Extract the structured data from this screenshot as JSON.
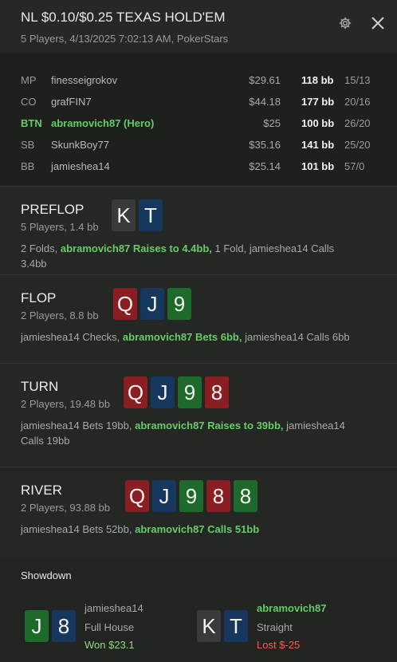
{
  "header": {
    "title": "NL $0.10/$0.25 TEXAS HOLD'EM",
    "subtitle": "5 Players, 4/13/2025 7:02:13 AM, PokerStars",
    "settings_icon": "gear-icon",
    "close_icon": "close-icon"
  },
  "players": [
    {
      "position": "MP",
      "name": "finesseigrokov",
      "stack": "$29.61",
      "bb": "118 bb",
      "stat": "15/13",
      "hero": false
    },
    {
      "position": "CO",
      "name": "grafFIN7",
      "stack": "$44.18",
      "bb": "177 bb",
      "stat": "20/16",
      "hero": false
    },
    {
      "position": "BTN",
      "name": "abramovich87 (Hero)",
      "stack": "$25",
      "bb": "100 bb",
      "stat": "26/20",
      "hero": true
    },
    {
      "position": "SB",
      "name": "SkunkBoy77",
      "stack": "$35.16",
      "bb": "141 bb",
      "stat": "25/20",
      "hero": false
    },
    {
      "position": "BB",
      "name": "jamieshea14",
      "stack": "$25.14",
      "bb": "101 bb",
      "stat": "57/0",
      "hero": false
    }
  ],
  "streets": {
    "preflop": {
      "name": "PREFLOP",
      "info": "5 Players, 1.4 bb",
      "cards": [
        {
          "rank": "K",
          "suit": "spades"
        },
        {
          "rank": "T",
          "suit": "diamonds"
        }
      ],
      "actions": [
        {
          "text": "2 Folds, ",
          "hero": false
        },
        {
          "text": "abramovich87 Raises to 4.4bb,",
          "hero": true
        },
        {
          "text": " 1 Fold, jamieshea14 Calls 3.4bb",
          "hero": false
        }
      ]
    },
    "flop": {
      "name": "FLOP",
      "info": "2 Players, 8.8 bb",
      "cards": [
        {
          "rank": "Q",
          "suit": "hearts"
        },
        {
          "rank": "J",
          "suit": "diamonds"
        },
        {
          "rank": "9",
          "suit": "clubs"
        }
      ],
      "actions": [
        {
          "text": "jamieshea14 Checks, ",
          "hero": false
        },
        {
          "text": "abramovich87 Bets 6bb,",
          "hero": true
        },
        {
          "text": " jamieshea14 Calls 6bb",
          "hero": false
        }
      ]
    },
    "turn": {
      "name": "TURN",
      "info": "2 Players, 19.48 bb",
      "cards": [
        {
          "rank": "Q",
          "suit": "hearts"
        },
        {
          "rank": "J",
          "suit": "diamonds"
        },
        {
          "rank": "9",
          "suit": "clubs"
        },
        {
          "rank": "8",
          "suit": "hearts"
        }
      ],
      "actions": [
        {
          "text": "jamieshea14 Bets 19bb, ",
          "hero": false
        },
        {
          "text": "abramovich87 Raises to 39bb,",
          "hero": true
        },
        {
          "text": " jamieshea14 Calls 19bb",
          "hero": false
        }
      ]
    },
    "river": {
      "name": "RIVER",
      "info": "2 Players, 93.88 bb",
      "cards": [
        {
          "rank": "Q",
          "suit": "hearts"
        },
        {
          "rank": "J",
          "suit": "diamonds"
        },
        {
          "rank": "9",
          "suit": "clubs"
        },
        {
          "rank": "8",
          "suit": "hearts"
        },
        {
          "rank": "8",
          "suit": "clubs"
        }
      ],
      "actions": [
        {
          "text": "jamieshea14 Bets 52bb, ",
          "hero": false
        },
        {
          "text": "abramovich87 Calls 51bb",
          "hero": true
        }
      ]
    }
  },
  "showdown": {
    "title": "Showdown",
    "players": [
      {
        "name": "jamieshea14",
        "hand": "Full House",
        "result": "Won $23.1",
        "won": true,
        "hero": false,
        "cards": [
          {
            "rank": "J",
            "suit": "clubs"
          },
          {
            "rank": "8",
            "suit": "diamonds"
          }
        ]
      },
      {
        "name": "abramovich87",
        "hand": "Straight",
        "result": "Lost $-25",
        "won": false,
        "hero": true,
        "cards": [
          {
            "rank": "K",
            "suit": "spades"
          },
          {
            "rank": "T",
            "suit": "diamonds"
          }
        ]
      }
    ]
  },
  "colors": {
    "hero_green": "#66cc66",
    "won_green": "#8ddc7c",
    "lost_red": "#ff5a4a",
    "suit_spades": "#3a3a3a",
    "suit_hearts": "#8a1e22",
    "suit_diamonds": "#17385e",
    "suit_clubs": "#1d6a2a"
  }
}
